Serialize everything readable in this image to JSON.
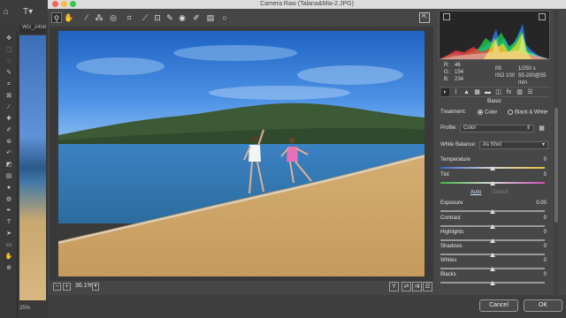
{
  "photoshop": {
    "doc_tab_label": "WG_2458.jP",
    "tools": [
      "move",
      "marquee",
      "lasso",
      "quick-select",
      "crop",
      "frame",
      "eyedropper",
      "healing",
      "brush",
      "clone",
      "history",
      "eraser",
      "gradient",
      "blur",
      "dodge",
      "pen",
      "type",
      "path-select",
      "shape",
      "hand",
      "zoom"
    ],
    "foot_text": "25%"
  },
  "dialog": {
    "title": "Camera Raw (Talana&Mia-2.JPG)",
    "zoom_level": "36.1%",
    "cancel_label": "Cancel",
    "ok_label": "OK",
    "view_y": "Y"
  },
  "toolbar": {
    "icons": [
      "zoom-icon",
      "hand-icon",
      "white-balance-icon",
      "color-sampler-icon",
      "target-adjust-icon",
      "crop-icon",
      "straighten-icon",
      "transform-icon",
      "spot-removal-icon",
      "red-eye-icon",
      "adjustment-brush-icon",
      "graduated-filter-icon",
      "radial-filter-icon"
    ]
  },
  "histogram": {
    "r_label": "R:",
    "r_value": "46",
    "g_label": "G:",
    "g_value": "154",
    "b_label": "B:",
    "b_value": "234",
    "aperture": "f/8",
    "shutter": "1/250 s",
    "iso": "ISO 100",
    "lens": "55-200@55 mm"
  },
  "panel": {
    "section_title": "Basic",
    "treatment_label": "Treatment:",
    "treatment_color": "Color",
    "treatment_bw": "Black & White",
    "profile_label": "Profile:",
    "profile_value": "Color",
    "wb_label": "White Balance:",
    "wb_value": "As Shot",
    "auto_label": "Auto",
    "default_label": "Default",
    "sliders": [
      {
        "label": "Temperature",
        "value": "0",
        "pos": 0.5
      },
      {
        "label": "Tint",
        "value": "0",
        "pos": 0.5
      },
      {
        "label": "Exposure",
        "value": "0.00",
        "pos": 0.5
      },
      {
        "label": "Contrast",
        "value": "0",
        "pos": 0.5
      },
      {
        "label": "Highlights",
        "value": "0",
        "pos": 0.5
      },
      {
        "label": "Shadows",
        "value": "0",
        "pos": 0.5
      },
      {
        "label": "Whites",
        "value": "0",
        "pos": 0.5
      },
      {
        "label": "Blacks",
        "value": "0",
        "pos": 0.5
      }
    ]
  },
  "colors": {
    "accent": "#4a90e2",
    "title_bar": "#dcdcdc",
    "dialog_bg": "#464646",
    "close_red": "#fc605b",
    "min_yellow": "#fdbc40",
    "max_green": "#34c84a"
  }
}
